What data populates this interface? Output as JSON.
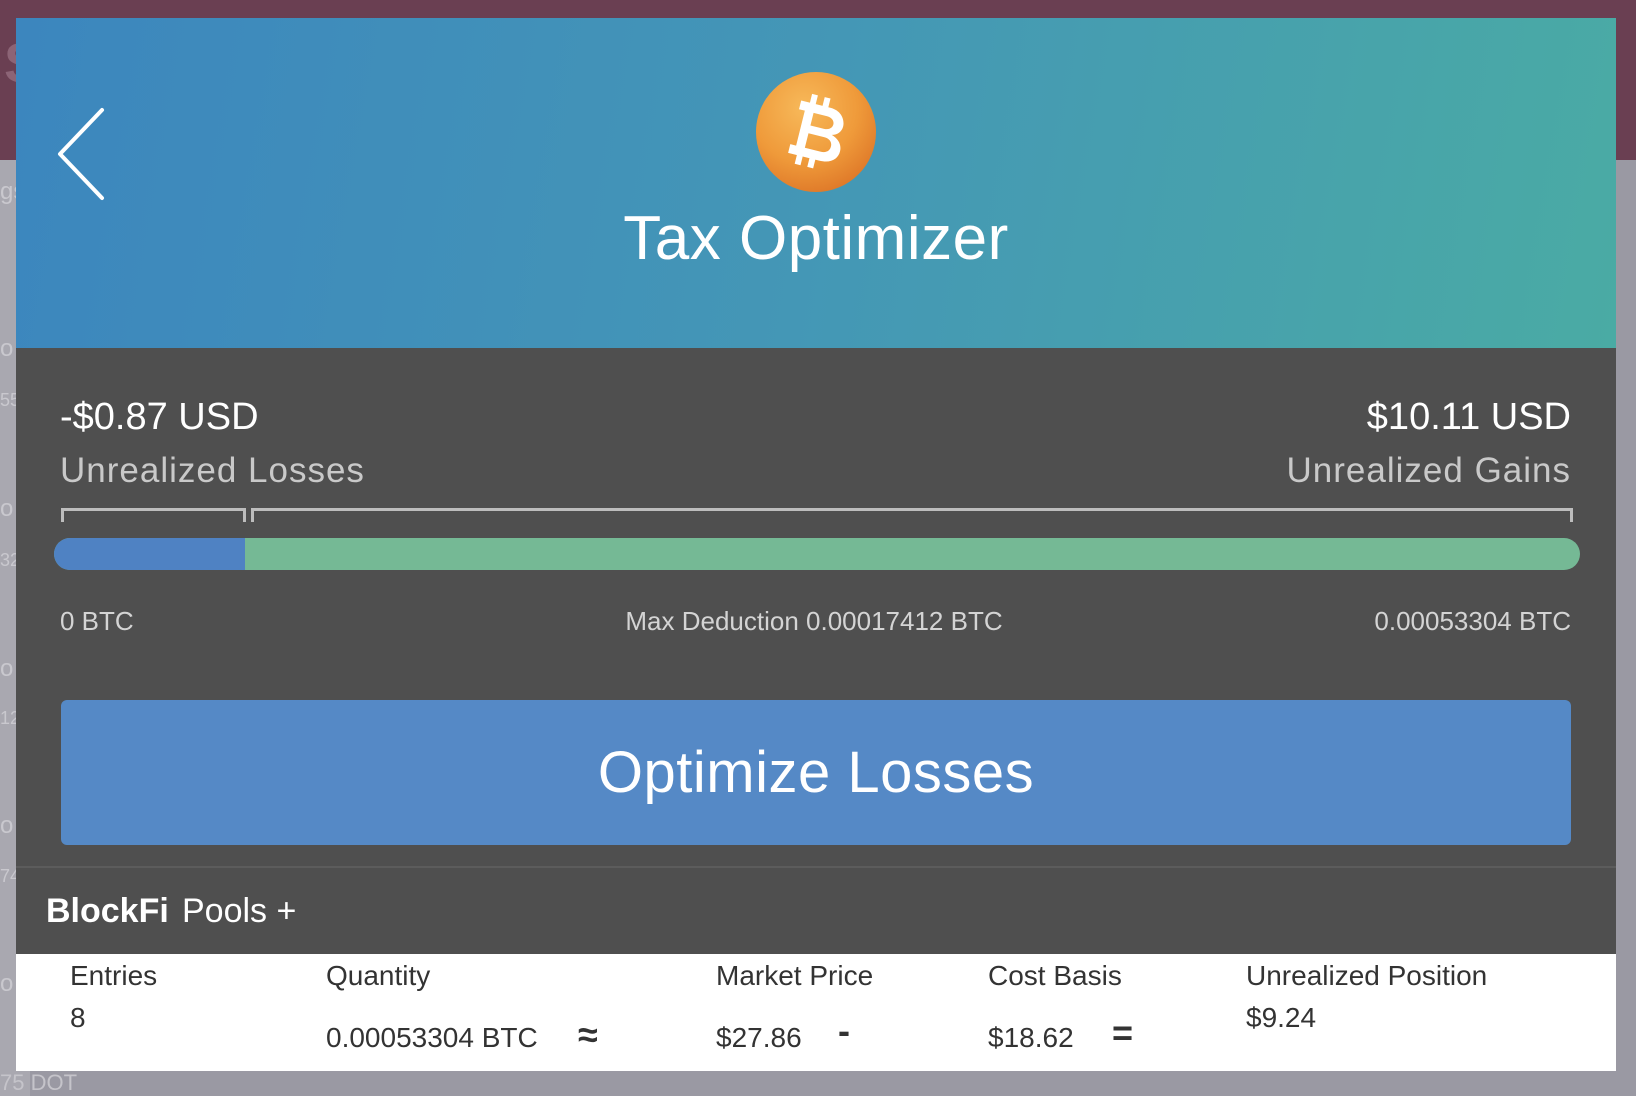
{
  "background": {
    "top_letter": "S",
    "fragments": [
      "gs",
      "o",
      "55",
      "o",
      "32",
      "o",
      "12",
      "o",
      "74",
      "o"
    ],
    "bottom_text": "75 DOT"
  },
  "header": {
    "back_icon": "chevron-left-icon",
    "coin_icon": "bitcoin-icon",
    "title": "Tax Optimizer"
  },
  "summary": {
    "losses_value": "-$0.87 USD",
    "losses_label": "Unrealized Losses",
    "gains_value": "$10.11 USD",
    "gains_label": "Unrealized Gains",
    "bar": {
      "loss_fraction": 0.125,
      "loss_color": "#4f82c3",
      "gain_color": "#75b995"
    },
    "scale_min": "0 BTC",
    "scale_mid": "Max Deduction 0.00017412  BTC",
    "scale_max": "0.00053304  BTC"
  },
  "action": {
    "optimize_label": "Optimize Losses"
  },
  "pool": {
    "name": "BlockFi",
    "sub": "Pools +"
  },
  "table": {
    "entries_header": "Entries",
    "entries_value": "8",
    "quantity_header": "Quantity",
    "quantity_value": "0.00053304  BTC",
    "approx": "≈",
    "market_price_header": "Market Price",
    "market_price_value": "$27.86",
    "minus": "-",
    "cost_basis_header": "Cost Basis",
    "cost_basis_value": "$18.62",
    "equals": "=",
    "unrealized_header": "Unrealized Position",
    "unrealized_value": "$9.24"
  },
  "colors": {
    "header_start": "#3c86be",
    "header_end": "#4aaba4",
    "button": "#5589c6",
    "panel": "#4f4f4f",
    "bitcoin_orange": "#f09a3a"
  }
}
